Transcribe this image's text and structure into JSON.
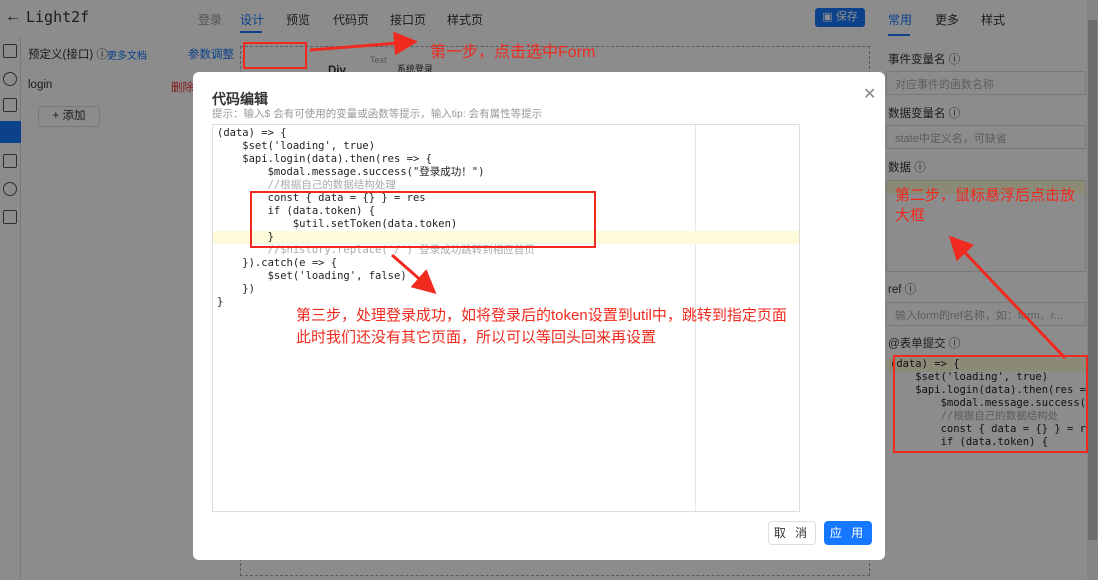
{
  "header": {
    "back_icon": "arrow-left-icon",
    "app_title": "Light2f",
    "tabs": [
      "登录",
      "设计",
      "预览",
      "代码页",
      "接口页",
      "样式页"
    ],
    "active_tab": "设计",
    "save_label": "保存",
    "accent": "#1677ff"
  },
  "left_panel": {
    "title": "预定义(接口)",
    "docs_link": "更多文档",
    "params_link": "参数调整",
    "items": [
      {
        "name": "login",
        "delete_label": "删除"
      }
    ],
    "add_label": "+ 添加"
  },
  "canvas": {
    "items": [
      "Div",
      "系统登录",
      "Text"
    ]
  },
  "right_panel": {
    "tabs": [
      "常用",
      "更多",
      "样式"
    ],
    "active_tab": "常用",
    "event_var_label": "事件变量名",
    "event_var_placeholder": "对应事件的函数名称",
    "data_var_label": "数据变量名",
    "data_var_placeholder": "state中定义名，可缺省",
    "data_label": "数据",
    "ref_label": "ref",
    "ref_placeholder": "输入form的ref名称，如：form、r...",
    "submit_label": "@表单提交",
    "submit_code": [
      "(data) => {",
      "    $set('loading', true)",
      "    $api.login(data).then(res =",
      "        $modal.message.success(",
      "        //根据自己的数据结构处",
      "        const { data = {} } = r",
      "        if (data.token) {"
    ]
  },
  "modal": {
    "title": "代码编辑",
    "hint": "提示：输入$ 会有可使用的变量或函数等提示，输入tip: 会有属性等提示",
    "cancel_label": "取 消",
    "apply_label": "应 用",
    "code": [
      "(data) => {",
      "    $set('loading', true)",
      "    $api.login(data).then(res => {",
      "        $modal.message.success(\"登录成功！\")",
      "        //根据自己的数据结构处理",
      "        const { data = {} } = res",
      "        if (data.token) {",
      "            $util.setToken(data.token)",
      "        }",
      "        //$history.replace('/') 登录成功跳转到相应首页",
      "    }).catch(e => {",
      "        $set('loading', false)",
      "    })",
      "}"
    ]
  },
  "annotations": {
    "step1": "第一步，点击选中Form",
    "step2": "第二步，鼠标悬浮后点击放大框",
    "step3_line1": "第三步，处理登录成功，如将登录后的token设置到util中，跳转到指定页面",
    "step3_line2": "此时我们还没有其它页面，所以可以等回头回来再设置",
    "color": "#f02a1e"
  }
}
